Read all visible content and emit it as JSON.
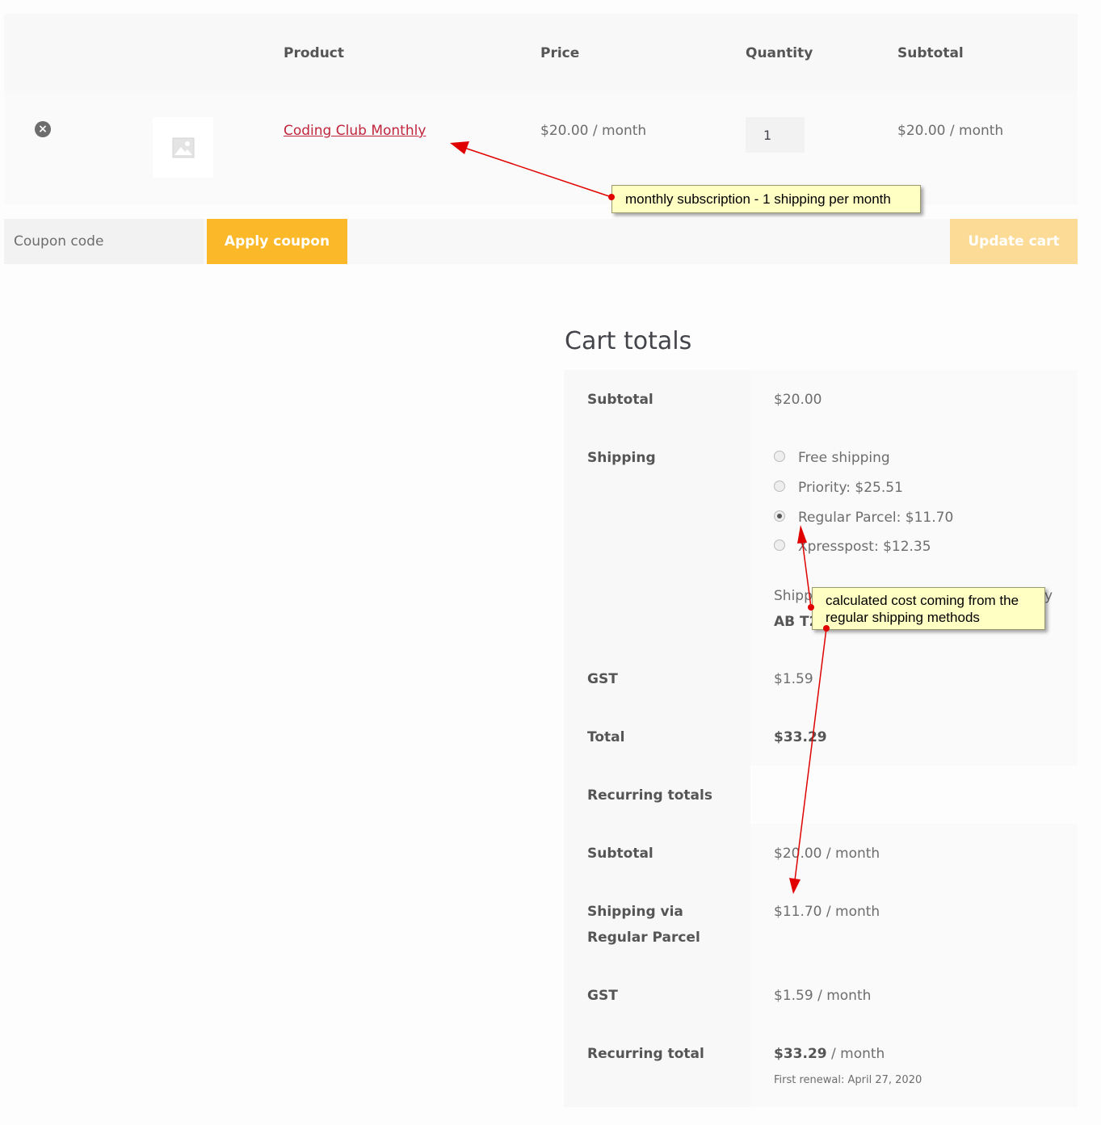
{
  "cart_table": {
    "headers": {
      "product": "Product",
      "price": "Price",
      "quantity": "Quantity",
      "subtotal": "Subtotal"
    },
    "row": {
      "remove_icon": "close-circle-icon",
      "thumbnail_icon": "image-placeholder-icon",
      "product_name": "Coding Club Monthly",
      "price": "$20.00",
      "price_period": " / month",
      "quantity": "1",
      "subtotal": "$20.00",
      "subtotal_period": " / month"
    }
  },
  "coupon": {
    "placeholder": "Coupon code",
    "apply_label": "Apply coupon",
    "update_label": "Update cart"
  },
  "cart_totals": {
    "title": "Cart totals",
    "subtotal_label": "Subtotal",
    "subtotal_value": "$20.00",
    "shipping_label": "Shipping",
    "shipping_options": [
      {
        "label": "Free shipping",
        "checked": false
      },
      {
        "label": "Priority: $25.51",
        "checked": false
      },
      {
        "label": "Regular Parcel: $11.70",
        "checked": true
      },
      {
        "label": "Xpresspost: $12.35",
        "checked": false
      }
    ],
    "shipping_to_line1": "Shipp",
    "shipping_to_line1_end": "y",
    "shipping_to_line2": "AB T2",
    "gst_label": "GST",
    "gst_value": "$1.59",
    "total_label": "Total",
    "total_value": "$33.29",
    "recurring_totals_label": "Recurring totals",
    "rec_subtotal_label": "Subtotal",
    "rec_subtotal_value": "$20.00 / month",
    "rec_shipping_label_1": "Shipping via",
    "rec_shipping_label_2": "Regular Parcel",
    "rec_shipping_value": "$11.70 / month",
    "rec_gst_label": "GST",
    "rec_gst_value": "$1.59 / month",
    "rec_total_label": "Recurring total",
    "rec_total_amount": "$33.29",
    "rec_total_period": " / month",
    "first_renewal": "First renewal: April 27, 2020"
  },
  "annotations": {
    "note1": "monthly subscription - 1 shipping per month",
    "note2_line1": "calculated cost coming from the",
    "note2_line2": "regular shipping methods"
  },
  "colors": {
    "link": "#c0263c",
    "apply_button": "#fbb829",
    "update_button": "#fcdb96",
    "annotation_bg": "#ffffc4",
    "arrow": "#e00000"
  }
}
